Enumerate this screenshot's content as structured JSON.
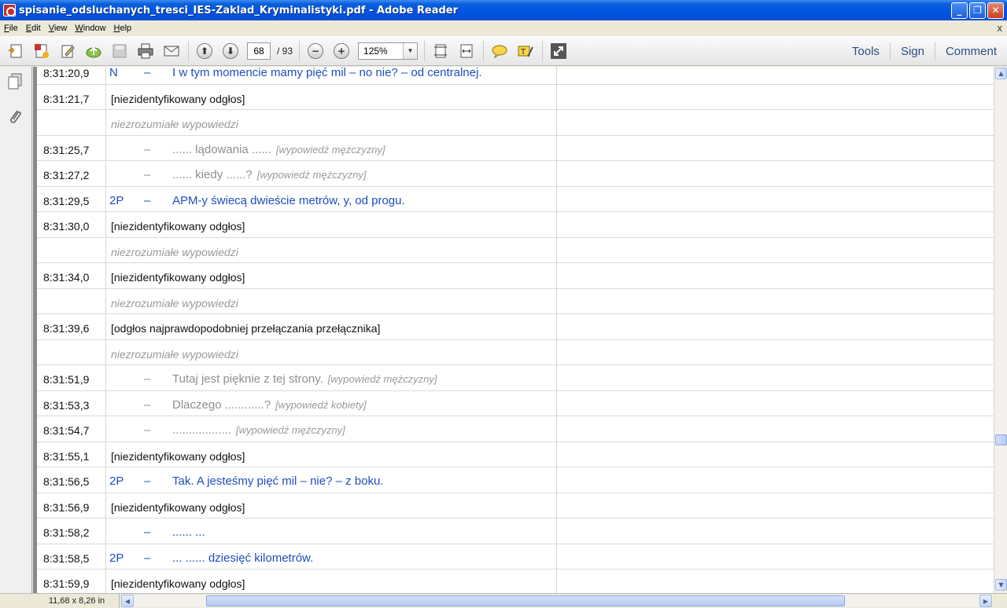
{
  "window": {
    "title": "spisanie_odsluchanych_tresci_IES-Zaklad_Kryminalistyki.pdf - Adobe Reader"
  },
  "menu": [
    {
      "label": "File"
    },
    {
      "label": "Edit"
    },
    {
      "label": "View"
    },
    {
      "label": "Window"
    },
    {
      "label": "Help"
    }
  ],
  "menu_close": "x",
  "toolbar": {
    "page_current": "68",
    "page_total": "/  93",
    "zoom": "125%",
    "tools_label": "Tools",
    "sign_label": "Sign",
    "comment_label": "Comment"
  },
  "status": {
    "page_size": "11,68 x 8,26 in"
  },
  "transcript": [
    {
      "time": "8:31:20,9",
      "speaker": "N",
      "dash": "–",
      "text": "I w tym momencie mamy pięć mil – no nie? – od centralnej.",
      "style": "blue"
    },
    {
      "time": "8:31:21,7",
      "text": "[niezidentyfikowany odgłos]",
      "style": "black"
    },
    {
      "time": "",
      "text": "niezrozumiałe wypowiedzi",
      "style": "grayital"
    },
    {
      "time": "8:31:25,7",
      "dash": "–",
      "text": "...... lądowania ......",
      "note": "[wypowiedź mężczyzny]",
      "style": "gray"
    },
    {
      "time": "8:31:27,2",
      "dash": "–",
      "text": "...... kiedy ......?",
      "note": "[wypowiedź mężczyzny]",
      "style": "gray"
    },
    {
      "time": "8:31:29,5",
      "speaker": "2P",
      "dash": "–",
      "text": "APM-y świecą dwieście metrów, y, od progu.",
      "style": "blue"
    },
    {
      "time": "8:31:30,0",
      "text": "[niezidentyfikowany odgłos]",
      "style": "black"
    },
    {
      "time": "",
      "text": "niezrozumiałe wypowiedzi",
      "style": "grayital"
    },
    {
      "time": "8:31:34,0",
      "text": "[niezidentyfikowany odgłos]",
      "style": "black"
    },
    {
      "time": "",
      "text": "niezrozumiałe wypowiedzi",
      "style": "grayital"
    },
    {
      "time": "8:31:39,6",
      "text": "[odgłos najprawdopodobniej przełączania przełącznika]",
      "style": "black"
    },
    {
      "time": "",
      "text": "niezrozumiałe wypowiedzi",
      "style": "grayital"
    },
    {
      "time": "8:31:51,9",
      "dash": "–",
      "text": "Tutaj jest pięknie z tej strony.",
      "note": "[wypowiedź mężczyzny]",
      "style": "gray"
    },
    {
      "time": "8:31:53,3",
      "dash": "–",
      "text": "Dlaczego ............?",
      "note": "[wypowiedź kobiety]",
      "style": "gray"
    },
    {
      "time": "8:31:54,7",
      "dash": "–",
      "text": "..................",
      "note": "[wypowiedź mężczyzny]",
      "style": "gray"
    },
    {
      "time": "8:31:55,1",
      "text": "[niezidentyfikowany odgłos]",
      "style": "black"
    },
    {
      "time": "8:31:56,5",
      "speaker": "2P",
      "dash": "–",
      "text": "Tak. A jesteśmy pięć mil – nie? – z boku.",
      "style": "blue"
    },
    {
      "time": "8:31:56,9",
      "text": "[niezidentyfikowany odgłos]",
      "style": "black"
    },
    {
      "time": "8:31:58,2",
      "dash": "–",
      "text": "...... ...",
      "style": "blue"
    },
    {
      "time": "8:31:58,5",
      "speaker": "2P",
      "dash": "–",
      "text": "... ...... dziesięć kilometrów.",
      "style": "blue"
    },
    {
      "time": "8:31:59,9",
      "text": "[niezidentyfikowany odgłos]",
      "style": "black"
    }
  ]
}
